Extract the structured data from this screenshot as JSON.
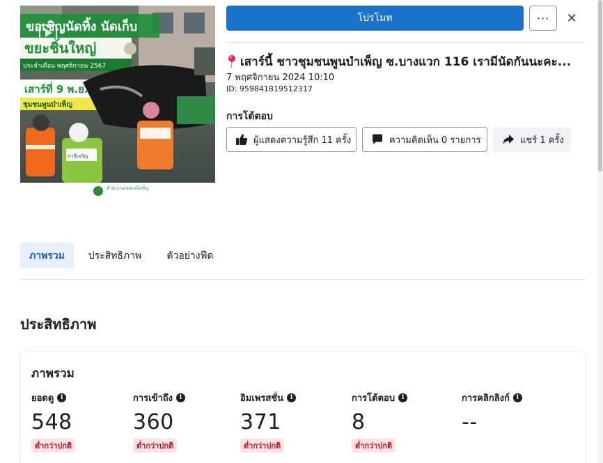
{
  "header": {
    "promote_label": "โปรโมท",
    "more_label": "···",
    "close_label": "✕"
  },
  "thumbnail": {
    "headline_1": "ขอเชิญนัดทิ้ง นัดเก็บ",
    "headline_2": "ขยะชิ้นใหญ่",
    "banner_month": "ประจำเดือน พฤศจิกายน 2567",
    "date_badge": "เสาร์ที่ 9 พ.ย. 67",
    "community": "ชุมชนพูนบำเพ็ญ",
    "vest_text": "ภาษีเจริญ",
    "footer_org": "สำนักงานเขตภาษีเจริญ"
  },
  "post": {
    "title": "เสาร์นี้ ชาวชุมชนพูนบำเพ็ญ ซ.บางแวก 116 เรามีนัดกันนะคะ...",
    "date": "7 พฤศจิกายน 2024 10:10",
    "id": "ID: 959841819512317"
  },
  "interactions": {
    "label": "การโต้ตอบ",
    "reactions": "ผู้แสดงความรู้สึก 11 ครั้ง",
    "comments": "ความคิดเห็น 0 รายการ",
    "shares": "แชร์ 1 ครั้ง"
  },
  "tabs": [
    {
      "label": "ภาพรวม",
      "active": true
    },
    {
      "label": "ประสิทธิภาพ",
      "active": false
    },
    {
      "label": "ตัวอย่างฟีด",
      "active": false
    }
  ],
  "performance": {
    "section_title": "ประสิทธิภาพ",
    "card_title": "ภาพรวม",
    "metrics": [
      {
        "label": "ยอดดู",
        "value": "548",
        "badge": "ต่ำกว่าปกติ"
      },
      {
        "label": "การเข้าถึง",
        "value": "360",
        "badge": "ต่ำกว่าปกติ"
      },
      {
        "label": "อิมเพรสชั่น",
        "value": "371",
        "badge": "ต่ำกว่าปกติ"
      },
      {
        "label": "การโต้ตอบ",
        "value": "8",
        "badge": "ต่ำกว่าปกติ"
      },
      {
        "label": "การคลิกลิงก์",
        "value": "--",
        "badge": ""
      }
    ]
  },
  "colors": {
    "accent": "#1a73c9",
    "badge_bg": "#ffe3e3",
    "badge_text": "#c0162b"
  }
}
